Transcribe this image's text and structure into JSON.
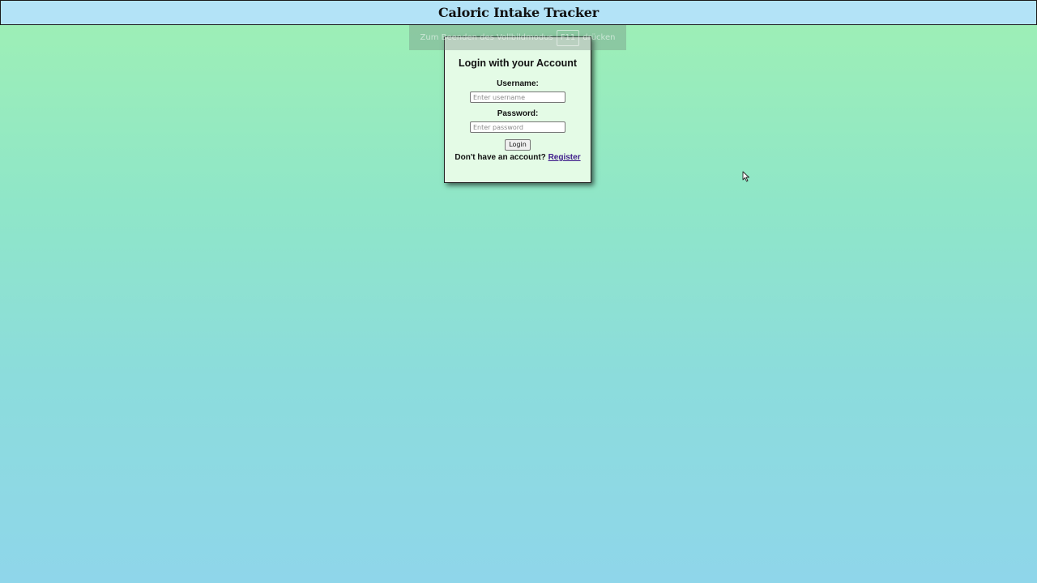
{
  "header": {
    "title": "Caloric Intake Tracker"
  },
  "fullscreen_banner": {
    "text_before": "Zum Beenden des Vollbildmodus",
    "key": "F11",
    "text_after": "drücken"
  },
  "login": {
    "title": "Login with your Account",
    "username_label": "Username:",
    "username_placeholder": "Enter username",
    "password_label": "Password:",
    "password_placeholder": "Enter password",
    "login_button": "Login",
    "register_prompt": "Don't have an account?",
    "register_link": "Register"
  },
  "colors": {
    "header_bg": "#b3e3f7",
    "card_bg": "#e4fbe6",
    "link": "#3d1a8a"
  }
}
